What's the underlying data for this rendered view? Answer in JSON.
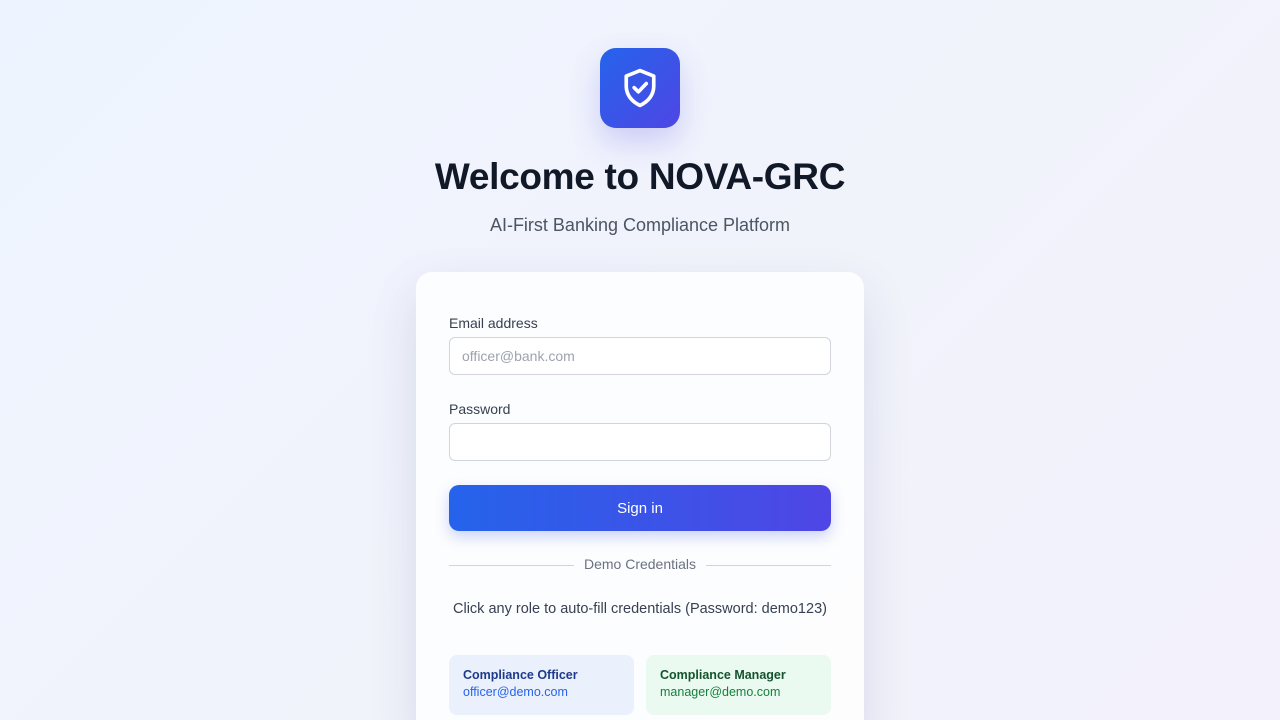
{
  "app": {
    "logo_icon": "shield-check-icon",
    "title": "Welcome to NOVA-GRC",
    "subtitle": "AI-First Banking Compliance Platform"
  },
  "form": {
    "email_label": "Email address",
    "email_placeholder": "officer@bank.com",
    "email_value": "",
    "password_label": "Password",
    "password_value": "",
    "signin_label": "Sign in"
  },
  "demo": {
    "divider_label": "Demo Credentials",
    "hint": "Click any role to auto-fill credentials (Password: demo123)",
    "roles": [
      {
        "name": "Compliance Officer",
        "email": "officer@demo.com",
        "color": "#eaf1fd"
      },
      {
        "name": "Compliance Manager",
        "email": "manager@demo.com",
        "color": "#eafaf0"
      }
    ]
  },
  "colors": {
    "accent_start": "#2563eb",
    "accent_end": "#4f46e5"
  }
}
